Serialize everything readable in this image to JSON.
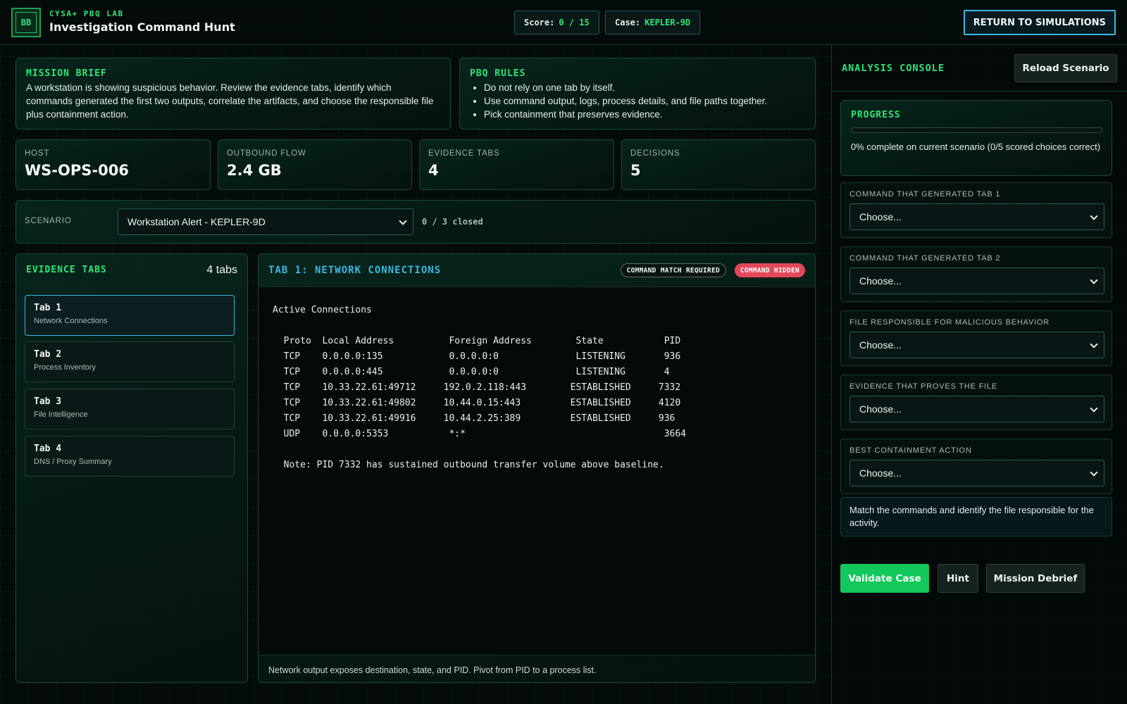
{
  "header": {
    "logo_text": "BB",
    "kicker": "CYSA+ PBQ LAB",
    "title": "Investigation Command Hunt",
    "score_label": "Score:",
    "score_value": "0 / 15",
    "case_label": "Case:",
    "case_value": "KEPLER-9D",
    "return_button": "RETURN TO SIMULATIONS"
  },
  "brief": {
    "title": "MISSION BRIEF",
    "text": "A workstation is showing suspicious behavior. Review the evidence tabs, identify which commands generated the first two outputs, correlate the artifacts, and choose the responsible file plus containment action."
  },
  "rules": {
    "title": "PBQ RULES",
    "items": [
      "Do not rely on one tab by itself.",
      "Use command output, logs, process details, and file paths together.",
      "Pick containment that preserves evidence."
    ]
  },
  "stats": [
    {
      "label": "HOST",
      "value": "WS-OPS-006"
    },
    {
      "label": "OUTBOUND FLOW",
      "value": "2.4 GB"
    },
    {
      "label": "EVIDENCE TABS",
      "value": "4"
    },
    {
      "label": "DECISIONS",
      "value": "5"
    }
  ],
  "scenario": {
    "label": "SCENARIO",
    "selected": "Workstation Alert - KEPLER-9D",
    "closed": "0 / 3 closed"
  },
  "evidence": {
    "title": "EVIDENCE TABS",
    "count": "4 tabs",
    "tabs": [
      {
        "title": "Tab 1",
        "subtitle": "Network Connections"
      },
      {
        "title": "Tab 2",
        "subtitle": "Process Inventory"
      },
      {
        "title": "Tab 3",
        "subtitle": "File Intelligence"
      },
      {
        "title": "Tab 4",
        "subtitle": "DNS / Proxy Summary"
      }
    ]
  },
  "viewer": {
    "title": "TAB 1: NETWORK CONNECTIONS",
    "badge_required": "COMMAND MATCH REQUIRED",
    "badge_hidden": "COMMAND HIDDEN",
    "output": "Active Connections\n\n  Proto  Local Address          Foreign Address        State           PID\n  TCP    0.0.0.0:135            0.0.0.0:0              LISTENING       936\n  TCP    0.0.0.0:445            0.0.0.0:0              LISTENING       4\n  TCP    10.33.22.61:49712     192.0.2.118:443        ESTABLISHED     7332\n  TCP    10.33.22.61:49802     10.44.0.15:443         ESTABLISHED     4120\n  TCP    10.33.22.61:49916     10.44.2.25:389         ESTABLISHED     936\n  UDP    0.0.0.0:5353           *:*                                    3664\n\n  Note: PID 7332 has sustained outbound transfer volume above baseline.",
    "footer": "Network output exposes destination, state, and PID. Pivot from PID to a process list."
  },
  "console": {
    "title": "ANALYSIS CONSOLE",
    "reload": "Reload Scenario",
    "progress_title": "PROGRESS",
    "progress_text": "0% complete on current scenario (0/5 scored choices correct)",
    "progress_fraction": 0,
    "fields": [
      {
        "label": "COMMAND THAT GENERATED TAB 1",
        "value": "Choose..."
      },
      {
        "label": "COMMAND THAT GENERATED TAB 2",
        "value": "Choose..."
      },
      {
        "label": "FILE RESPONSIBLE FOR MALICIOUS BEHAVIOR",
        "value": "Choose..."
      },
      {
        "label": "EVIDENCE THAT PROVES THE FILE",
        "value": "Choose..."
      },
      {
        "label": "BEST CONTAINMENT ACTION",
        "value": "Choose..."
      }
    ],
    "hint_text": "Match the commands and identify the file responsible for the activity.",
    "validate": "Validate Case",
    "hint": "Hint",
    "debrief": "Mission Debrief"
  },
  "colors": {
    "accent": "#2ee57a",
    "cyan": "#3ab7e0",
    "danger": "#e2475a",
    "validate": "#13c75a"
  }
}
